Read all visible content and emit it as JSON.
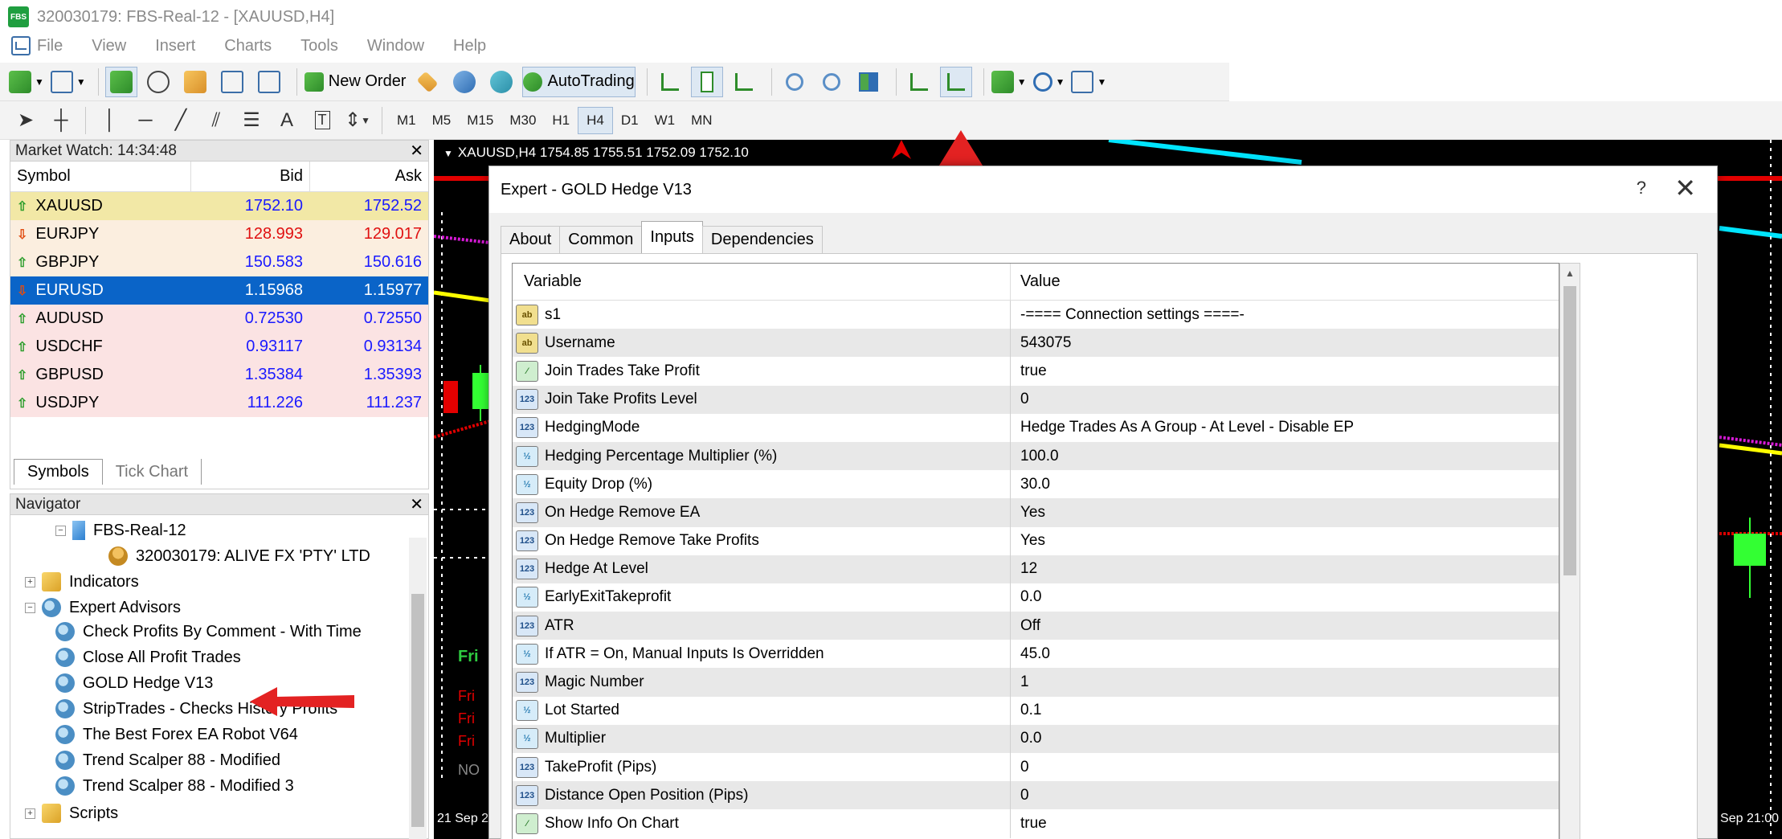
{
  "window": {
    "title": "320030179: FBS-Real-12 - [XAUUSD,H4]",
    "app_badge": "FBS"
  },
  "menu": [
    "File",
    "View",
    "Insert",
    "Charts",
    "Tools",
    "Window",
    "Help"
  ],
  "toolbar": {
    "new_order": "New Order",
    "autotrading": "AutoTrading"
  },
  "timeframes": [
    "M1",
    "M5",
    "M15",
    "M30",
    "H1",
    "H4",
    "D1",
    "W1",
    "MN"
  ],
  "active_timeframe": "H4",
  "drawing_tools": {
    "text_tool": "A",
    "text_label_tool": "T"
  },
  "market_watch": {
    "title": "Market Watch: 14:34:48",
    "columns": {
      "symbol": "Symbol",
      "bid": "Bid",
      "ask": "Ask"
    },
    "rows": [
      {
        "symbol": "XAUUSD",
        "bid": "1752.10",
        "ask": "1752.52",
        "direction": "up"
      },
      {
        "symbol": "EURJPY",
        "bid": "128.993",
        "ask": "129.017",
        "direction": "down"
      },
      {
        "symbol": "GBPJPY",
        "bid": "150.583",
        "ask": "150.616",
        "direction": "up"
      },
      {
        "symbol": "EURUSD",
        "bid": "1.15968",
        "ask": "1.15977",
        "direction": "down"
      },
      {
        "symbol": "AUDUSD",
        "bid": "0.72530",
        "ask": "0.72550",
        "direction": "up"
      },
      {
        "symbol": "USDCHF",
        "bid": "0.93117",
        "ask": "0.93134",
        "direction": "up"
      },
      {
        "symbol": "GBPUSD",
        "bid": "1.35384",
        "ask": "1.35393",
        "direction": "up"
      },
      {
        "symbol": "USDJPY",
        "bid": "111.226",
        "ask": "111.237",
        "direction": "up"
      }
    ],
    "tabs": [
      "Symbols",
      "Tick Chart"
    ]
  },
  "navigator": {
    "title": "Navigator",
    "server": "FBS-Real-12",
    "account": "320030179: ALIVE FX 'PTY' LTD",
    "indicators": "Indicators",
    "expert_advisors": "Expert Advisors",
    "experts": [
      "Check Profits By Comment - With Time",
      "Close All Profit Trades",
      "GOLD Hedge V13",
      "StripTrades - Checks History Profits",
      "The Best Forex EA Robot V64",
      "Trend Scalper 88 - Modified",
      "Trend Scalper 88 - Modified 3"
    ],
    "scripts": "Scripts"
  },
  "chart": {
    "label": "XAUUSD,H4  1754.85 1755.51 1752.09 1752.10",
    "bottom_left": "21 Sep 2",
    "bottom_right": "Sep 21:00",
    "panel_header": "Fri",
    "panel_lines": [
      "Fri",
      "Fri",
      "Fri"
    ],
    "panel_footer": "NO"
  },
  "dialog": {
    "title": "Expert - GOLD Hedge V13",
    "help": "?",
    "close": "✕",
    "tabs": [
      "About",
      "Common",
      "Inputs",
      "Dependencies"
    ],
    "active_tab": "Inputs",
    "columns": {
      "variable": "Variable",
      "value": "Value"
    },
    "inputs": [
      {
        "type": "ab",
        "name": "s1",
        "value": "-==== Connection settings ====-"
      },
      {
        "type": "ab",
        "name": "Username",
        "value": "543075"
      },
      {
        "type": "bool",
        "name": "Join Trades Take Profit",
        "value": "true"
      },
      {
        "type": "123",
        "name": "Join Take Profits Level",
        "value": "0"
      },
      {
        "type": "123",
        "name": "HedgingMode",
        "value": "Hedge Trades As A Group - At Level - Disable EP"
      },
      {
        "type": "v2",
        "name": "Hedging Percentage Multiplier (%)",
        "value": "100.0"
      },
      {
        "type": "v2",
        "name": "Equity Drop (%)",
        "value": "30.0"
      },
      {
        "type": "123",
        "name": "On Hedge Remove EA",
        "value": "Yes"
      },
      {
        "type": "123",
        "name": "On Hedge Remove Take Profits",
        "value": "Yes"
      },
      {
        "type": "123",
        "name": "Hedge At Level",
        "value": "12"
      },
      {
        "type": "v2",
        "name": "EarlyExitTakeprofit",
        "value": "0.0"
      },
      {
        "type": "123",
        "name": "ATR",
        "value": "Off"
      },
      {
        "type": "v2",
        "name": "If ATR = On, Manual Inputs Is Overridden",
        "value": "45.0"
      },
      {
        "type": "123",
        "name": "Magic Number",
        "value": "1"
      },
      {
        "type": "v2",
        "name": "Lot Started",
        "value": "0.1"
      },
      {
        "type": "v2",
        "name": "Multiplier",
        "value": "0.0"
      },
      {
        "type": "123",
        "name": "TakeProfit (Pips)",
        "value": "0"
      },
      {
        "type": "123",
        "name": "Distance Open Position (Pips)",
        "value": "0"
      },
      {
        "type": "bool",
        "name": "Show Info On Chart",
        "value": "true"
      }
    ]
  },
  "colors": {
    "selected_row": "#0a64c8",
    "bid_blue": "#1a1aff",
    "down_red": "#e01010",
    "annotation_red": "#e32222"
  }
}
